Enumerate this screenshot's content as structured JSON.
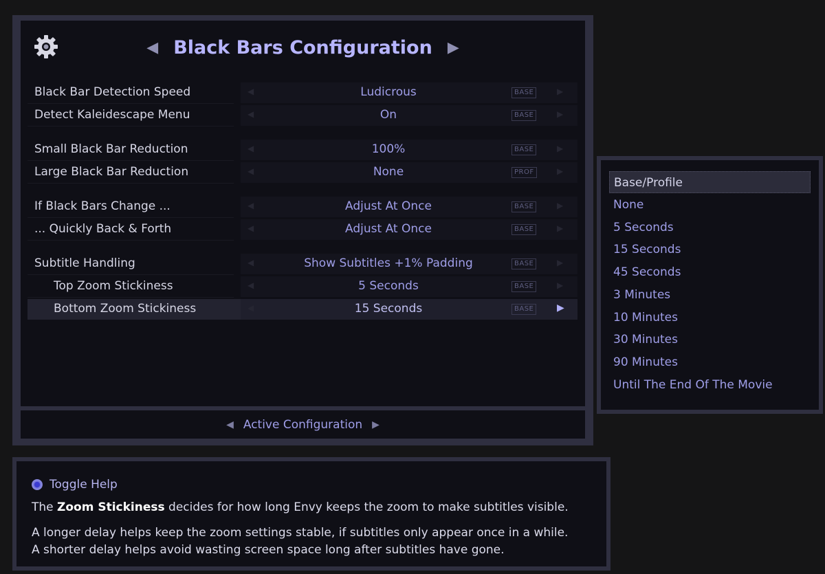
{
  "header": {
    "title": "Black Bars Configuration",
    "left_arrow": "◀",
    "right_arrow": "▶",
    "icon": "gear-icon"
  },
  "settings": [
    {
      "label": "Black Bar Detection Speed",
      "value": "Ludicrous",
      "tag": "BASE"
    },
    {
      "label": "Detect Kaleidescape Menu",
      "value": "On",
      "tag": "BASE"
    },
    {
      "label": "Small Black Bar Reduction",
      "value": "100%",
      "tag": "BASE"
    },
    {
      "label": "Large Black Bar Reduction",
      "value": "None",
      "tag": "PROF"
    },
    {
      "label": "If Black Bars Change ...",
      "value": "Adjust At Once",
      "tag": "BASE"
    },
    {
      "label": "... Quickly Back & Forth",
      "value": "Adjust At Once",
      "tag": "BASE"
    },
    {
      "label": "Subtitle Handling",
      "value": "Show Subtitles +1% Padding",
      "tag": "BASE"
    },
    {
      "label": "Top Zoom Stickiness",
      "value": "5 Seconds",
      "tag": "BASE"
    },
    {
      "label": "Bottom Zoom Stickiness",
      "value": "15 Seconds",
      "tag": "BASE"
    }
  ],
  "arrows": {
    "left": "◀",
    "right": "▶"
  },
  "footer": {
    "label": "Active Configuration",
    "left_arrow": "◀",
    "right_arrow": "▶"
  },
  "dropdown": {
    "options": [
      "Base/Profile",
      "None",
      "5 Seconds",
      "15 Seconds",
      "45 Seconds",
      "3 Minutes",
      "10 Minutes",
      "30 Minutes",
      "90 Minutes",
      "Until The End Of The Movie"
    ],
    "highlighted": "Base/Profile"
  },
  "help": {
    "toggle_label": "Toggle Help",
    "line1_pre": "The ",
    "line1_bold": "Zoom Stickiness",
    "line1_post": " decides for how long Envy keeps the zoom to make subtitles visible.",
    "line2": "A longer delay helps keep the zoom settings stable, if subtitles only appear once in a while.",
    "line3": "A shorter delay helps avoid wasting screen space long after subtitles have gone."
  },
  "colors": {
    "accent": "#b7b5ff",
    "value_text": "#9f9ee8",
    "panel_border": "#2f2f40",
    "panel_bg": "#0f0f16"
  }
}
